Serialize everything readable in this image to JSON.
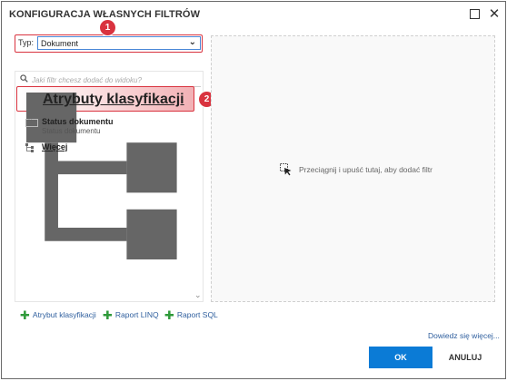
{
  "window": {
    "title": "KONFIGURACJA WŁASNYCH FILTRÓW",
    "maximize_icon": "maximize-icon",
    "close_icon": "close-icon"
  },
  "type_selector": {
    "label": "Typ:",
    "selected": "Dokument"
  },
  "callouts": [
    "1",
    "2"
  ],
  "search": {
    "placeholder": "Jaki filtr chcesz dodać do widoku?"
  },
  "filter_list": {
    "items": [
      {
        "label": "Atrybuty klasyfikacji",
        "icon": "hierarchy-icon"
      },
      {
        "label": "Status dokumentu",
        "subtitle": "Status dokumentu",
        "icon": "abc-text-icon",
        "icon_text": "Abc"
      },
      {
        "label": "Więcej",
        "icon": "hierarchy-icon"
      }
    ]
  },
  "drop_zone": {
    "text": "Przeciągnij i upuść tutaj, aby dodać filtr"
  },
  "add_buttons": [
    {
      "label": "Atrybut klasyfikacji"
    },
    {
      "label": "Raport LINQ"
    },
    {
      "label": "Raport SQL"
    }
  ],
  "footer": {
    "learn_more": "Dowiedz się więcej...",
    "ok": "OK",
    "cancel": "ANULUJ"
  },
  "colors": {
    "accent": "#0b7bd6",
    "highlight_border": "#d9333f",
    "link": "#2f5f9e",
    "plus": "#2f9a3a"
  }
}
